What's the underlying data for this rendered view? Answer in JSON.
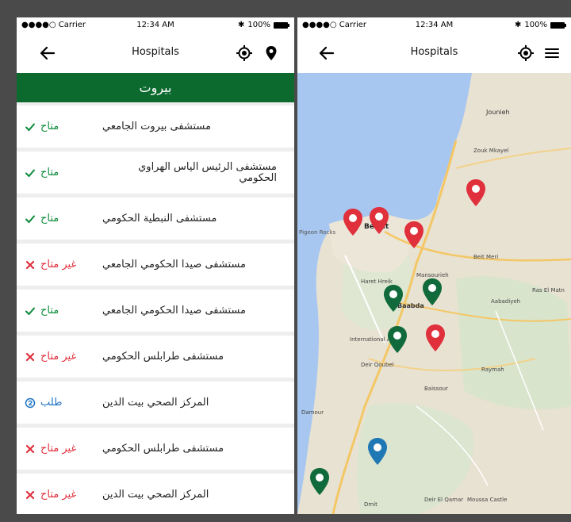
{
  "status_bar": {
    "carrier": "●●●●○ Carrier",
    "time": "12:34 AM",
    "battery": "100%"
  },
  "left": {
    "title": "Hospitals",
    "region": "بيروت",
    "rows": [
      {
        "name": "مستشفى بيروت الجامعي",
        "status": "متاح",
        "kind": "available"
      },
      {
        "name": "مستشفى الرئيس الياس الهراوي الحكومي",
        "status": "متاح",
        "kind": "available"
      },
      {
        "name": "مستشفى النبطية الحكومي",
        "status": "متاح",
        "kind": "available"
      },
      {
        "name": "مستشفى صيدا الحكومي الجامعي",
        "status": "غير متاح",
        "kind": "unavailable"
      },
      {
        "name": "مستشفى صيدا الحكومي الجامعي",
        "status": "متاح",
        "kind": "available"
      },
      {
        "name": "مستشفى طرابلس الحكومي",
        "status": "غير متاح",
        "kind": "unavailable"
      },
      {
        "name": "المركز الصحي بيت الدين",
        "status": "طلب",
        "kind": "request"
      },
      {
        "name": "مستشفى طرابلس الحكومي",
        "status": "غير متاح",
        "kind": "unavailable"
      },
      {
        "name": "المركز الصحي بيت الدين",
        "status": "غير متاح",
        "kind": "unavailable"
      }
    ]
  },
  "right": {
    "title": "Hospitals",
    "map_labels": {
      "jounieh": "Jounieh",
      "zouk": "Zouk Mkayel",
      "baabda": "Baabda",
      "mansourieh": "Mansourieh",
      "hadath": "Haret Hreik",
      "airport": "International Airport",
      "beit_meri": "Beit Meri",
      "aley": "Aabadiyeh",
      "damour": "Damour",
      "dmit": "Dmit",
      "kfarchima": "Deir Qoubel",
      "bchamoun": "Baissour",
      "ras_el_matn": "Ras El Matn",
      "rayfoun": "Raymah",
      "rocks": "Pigeon Rocks",
      "moussa": "Moussa Castle",
      "deir_qamar": "Deir El Qamar",
      "beirut": "Beirut"
    }
  },
  "colors": {
    "accent_green": "#0c6a2f",
    "available": "#0c8a3a",
    "unavailable": "#e02f3b",
    "request": "#1d73c4",
    "pin_red": "#e0303c",
    "pin_green": "#106a3b",
    "pin_blue": "#1f78b4"
  }
}
